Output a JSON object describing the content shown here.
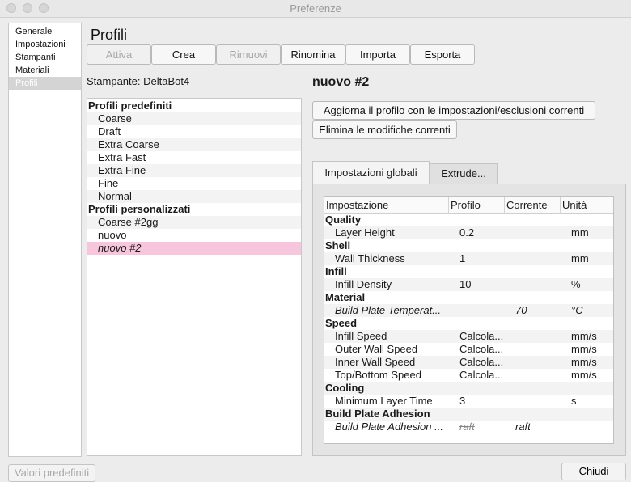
{
  "window": {
    "title": "Preferenze"
  },
  "sidebar": {
    "items": [
      {
        "label": "Generale"
      },
      {
        "label": "Impostazioni"
      },
      {
        "label": "Stampanti"
      },
      {
        "label": "Materiali"
      },
      {
        "label": "Profili",
        "selected": true
      }
    ]
  },
  "page": {
    "title": "Profili",
    "printer_label": "Stampante: DeltaBot4",
    "selected_profile": "nuovo #2"
  },
  "toolbar": {
    "activate": "Attiva",
    "create": "Crea",
    "remove": "Rimuovi",
    "rename": "Rinomina",
    "import": "Importa",
    "export": "Esporta"
  },
  "actions": {
    "update_profile": "Aggiorna il profilo con le impostazioni/esclusioni correnti",
    "discard_changes": "Elimina le modifiche correnti"
  },
  "profiles": {
    "predefined_header": "Profili predefiniti",
    "predefined": [
      "Coarse",
      "Draft",
      "Extra Coarse",
      "Extra Fast",
      "Extra Fine",
      "Fine",
      "Normal"
    ],
    "custom_header": "Profili personalizzati",
    "custom": [
      "Coarse #2gg",
      "nuovo",
      "nuovo #2"
    ],
    "selected": "nuovo #2"
  },
  "tabs": [
    {
      "label": "Impostazioni globali",
      "active": true
    },
    {
      "label": "Extrude...",
      "active": false
    }
  ],
  "table": {
    "columns": [
      "Impostazione",
      "Profilo",
      "Corrente",
      "Unità"
    ],
    "rows": [
      {
        "group": "Quality"
      },
      {
        "name": "Layer Height",
        "profile": "0.2",
        "current": "",
        "unit": "mm"
      },
      {
        "group": "Shell"
      },
      {
        "name": "Wall Thickness",
        "profile": "1",
        "current": "",
        "unit": "mm"
      },
      {
        "group": "Infill"
      },
      {
        "name": "Infill Density",
        "profile": "10",
        "current": "",
        "unit": "%"
      },
      {
        "group": "Material"
      },
      {
        "name": "Build Plate Temperat...",
        "profile": "",
        "current": "70",
        "unit": "°C",
        "italic": true
      },
      {
        "group": "Speed"
      },
      {
        "name": "Infill Speed",
        "profile": "Calcola...",
        "current": "",
        "unit": "mm/s"
      },
      {
        "name": "Outer Wall Speed",
        "profile": "Calcola...",
        "current": "",
        "unit": "mm/s"
      },
      {
        "name": "Inner Wall Speed",
        "profile": "Calcola...",
        "current": "",
        "unit": "mm/s"
      },
      {
        "name": "Top/Bottom Speed",
        "profile": "Calcola...",
        "current": "",
        "unit": "mm/s"
      },
      {
        "group": "Cooling"
      },
      {
        "name": "Minimum Layer Time",
        "profile": "3",
        "current": "",
        "unit": "s"
      },
      {
        "group": "Build Plate Adhesion"
      },
      {
        "name": "Build Plate Adhesion ...",
        "profile": "raft",
        "current": "raft",
        "unit": "",
        "italic": true,
        "profile_struck": true
      }
    ]
  },
  "footer": {
    "defaults": "Valori predefiniti",
    "close": "Chiudi"
  },
  "colors": {
    "selection_pink": "#f8c6dc",
    "window_bg": "#ececec"
  }
}
